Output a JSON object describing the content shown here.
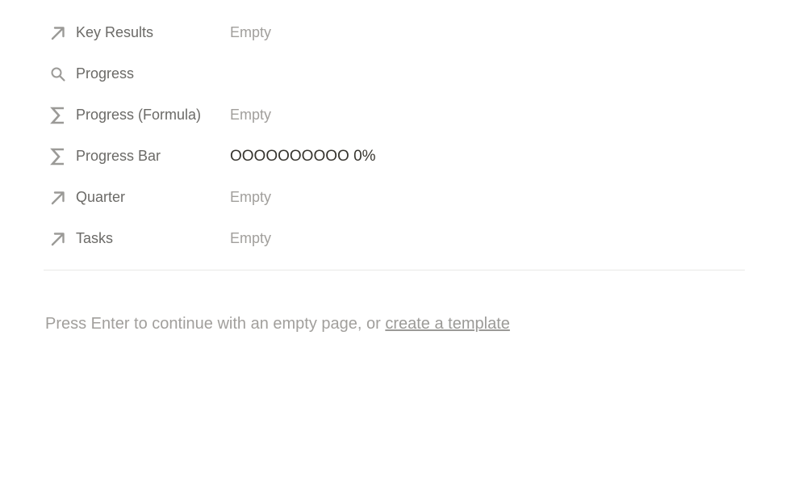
{
  "properties": [
    {
      "icon": "arrow-up-right-icon",
      "label": "Key Results",
      "value": "Empty",
      "empty": true
    },
    {
      "icon": "search-icon",
      "label": "Progress",
      "value": "",
      "empty": true
    },
    {
      "icon": "sigma-icon",
      "label": "Progress (Formula)",
      "value": "Empty",
      "empty": true
    },
    {
      "icon": "sigma-icon",
      "label": "Progress Bar",
      "value": "OOOOOOOOOO 0%",
      "empty": false
    },
    {
      "icon": "arrow-up-right-icon",
      "label": "Quarter",
      "value": "Empty",
      "empty": true
    },
    {
      "icon": "arrow-up-right-icon",
      "label": "Tasks",
      "value": "Empty",
      "empty": true
    }
  ],
  "hint": {
    "text": "Press Enter to continue with an empty page, or ",
    "link": "create a template"
  },
  "colors": {
    "label": "#6b6a67",
    "empty": "#a19f9c",
    "text": "#37352f",
    "divider": "#e9e9e7"
  }
}
